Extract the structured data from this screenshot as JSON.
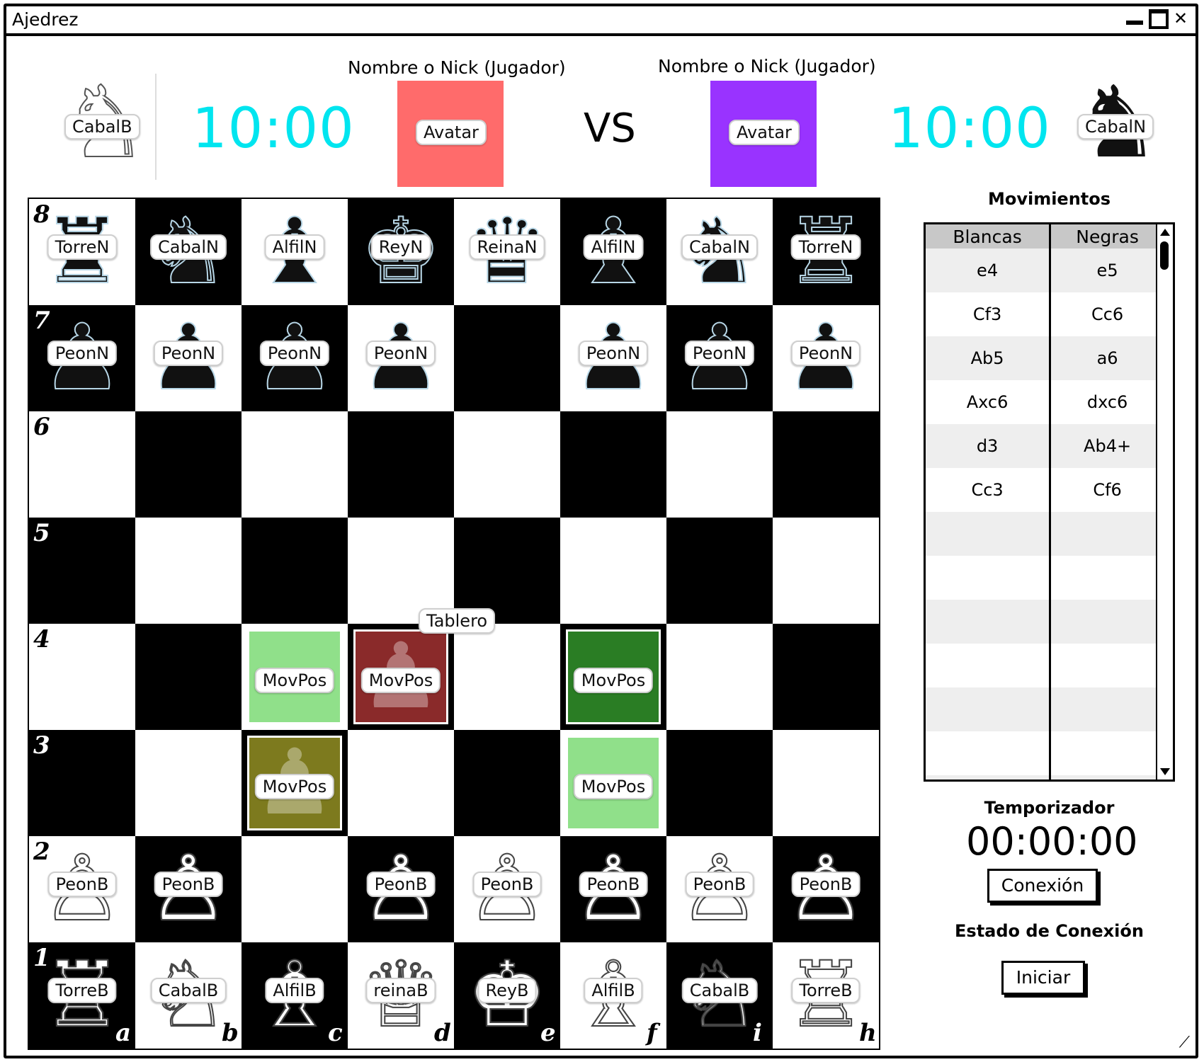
{
  "window": {
    "title": "Ajedrez",
    "min_label": "",
    "max_label": "",
    "close_label": "✕"
  },
  "header": {
    "left_piece": {
      "glyph": "♞",
      "label": "CabalB"
    },
    "right_piece": {
      "glyph": "♞",
      "label": "CabalN"
    },
    "player1": {
      "name": "Nombre o Nick (Jugador)",
      "avatar_label": "Avatar",
      "avatar_color": "#ff6b6b",
      "timer": "10:00"
    },
    "player2": {
      "name": "Nombre o Nick (Jugador)",
      "avatar_label": "Avatar",
      "avatar_color": "#9933ff",
      "timer": "10:00"
    },
    "vs": "VS",
    "timer_color": "#00e5ef"
  },
  "board": {
    "label": "Tablero",
    "ranks": [
      "8",
      "7",
      "6",
      "5",
      "4",
      "3",
      "2",
      "1"
    ],
    "files": [
      "a",
      "b",
      "c",
      "d",
      "e",
      "f",
      "i",
      "h"
    ],
    "rows": [
      [
        {
          "glyph": "♜",
          "label": "TorreN",
          "color": "black"
        },
        {
          "glyph": "♞",
          "label": "CabalN",
          "color": "black"
        },
        {
          "glyph": "♝",
          "label": "AlfilN",
          "color": "black"
        },
        {
          "glyph": "♚",
          "label": "ReyN",
          "color": "black"
        },
        {
          "glyph": "♛",
          "label": "ReinaN",
          "color": "black"
        },
        {
          "glyph": "♝",
          "label": "AlfilN",
          "color": "black"
        },
        {
          "glyph": "♞",
          "label": "CabalN",
          "color": "black"
        },
        {
          "glyph": "♜",
          "label": "TorreN",
          "color": "black"
        }
      ],
      [
        {
          "glyph": "♟",
          "label": "PeonN",
          "color": "black"
        },
        {
          "glyph": "♟",
          "label": "PeonN",
          "color": "black"
        },
        {
          "glyph": "♟",
          "label": "PeonN",
          "color": "black"
        },
        {
          "glyph": "♟",
          "label": "PeonN",
          "color": "black"
        },
        null,
        {
          "glyph": "♟",
          "label": "PeonN",
          "color": "black"
        },
        {
          "glyph": "♟",
          "label": "PeonN",
          "color": "black"
        },
        {
          "glyph": "♟",
          "label": "PeonN",
          "color": "black"
        }
      ],
      [
        null,
        null,
        null,
        null,
        null,
        null,
        null,
        null
      ],
      [
        null,
        null,
        null,
        null,
        null,
        null,
        null,
        null
      ],
      [
        null,
        null,
        {
          "label": "MovPos",
          "highlight": "#90e08a"
        },
        {
          "label": "MovPos",
          "highlight": "#8a2a2a",
          "ghost": "♟"
        },
        null,
        {
          "label": "MovPos",
          "highlight": "#2a7d24"
        },
        null,
        null
      ],
      [
        null,
        null,
        {
          "label": "MovPos",
          "highlight": "#7d7a1e",
          "ghost": "♟"
        },
        null,
        null,
        {
          "label": "MovPos",
          "highlight": "#90e08a"
        },
        null,
        null
      ],
      [
        {
          "glyph": "♙",
          "label": "PeonB",
          "color": "white"
        },
        {
          "glyph": "♙",
          "label": "PeonB",
          "color": "white"
        },
        null,
        {
          "glyph": "♙",
          "label": "PeonB",
          "color": "white"
        },
        {
          "glyph": "♙",
          "label": "PeonB",
          "color": "white"
        },
        {
          "glyph": "♙",
          "label": "PeonB",
          "color": "white"
        },
        {
          "glyph": "♙",
          "label": "PeonB",
          "color": "white"
        },
        {
          "glyph": "♙",
          "label": "PeonB",
          "color": "white"
        }
      ],
      [
        {
          "glyph": "♖",
          "label": "TorreB",
          "color": "white"
        },
        {
          "glyph": "♘",
          "label": "CabalB",
          "color": "white"
        },
        {
          "glyph": "♗",
          "label": "AlfilB",
          "color": "white"
        },
        {
          "glyph": "♕",
          "label": "reinaB",
          "color": "white"
        },
        {
          "glyph": "♔",
          "label": "ReyB",
          "color": "white"
        },
        {
          "glyph": "♗",
          "label": "AlfilB",
          "color": "white"
        },
        {
          "glyph": "♘",
          "label": "CabalB",
          "color": "white"
        },
        {
          "glyph": "♖",
          "label": "TorreB",
          "color": "white"
        }
      ]
    ]
  },
  "moves_panel": {
    "title": "Movimientos",
    "columns": [
      "Blancas",
      "Negras"
    ],
    "rows": [
      [
        "e4",
        "e5"
      ],
      [
        "Cf3",
        "Cc6"
      ],
      [
        "Ab5",
        "a6"
      ],
      [
        "Axc6",
        "dxc6"
      ],
      [
        "d3",
        "Ab4+"
      ],
      [
        "Cc3",
        "Cf6"
      ],
      [
        "",
        ""
      ],
      [
        "",
        ""
      ],
      [
        "",
        ""
      ],
      [
        "",
        ""
      ],
      [
        "",
        ""
      ],
      [
        "",
        ""
      ],
      [
        "",
        ""
      ]
    ]
  },
  "timer_panel": {
    "title": "Temporizador",
    "value": "00:00:00"
  },
  "connection": {
    "button_label": "Conexión",
    "status_label": "Estado de Conexión",
    "start_label": "Iniciar"
  }
}
